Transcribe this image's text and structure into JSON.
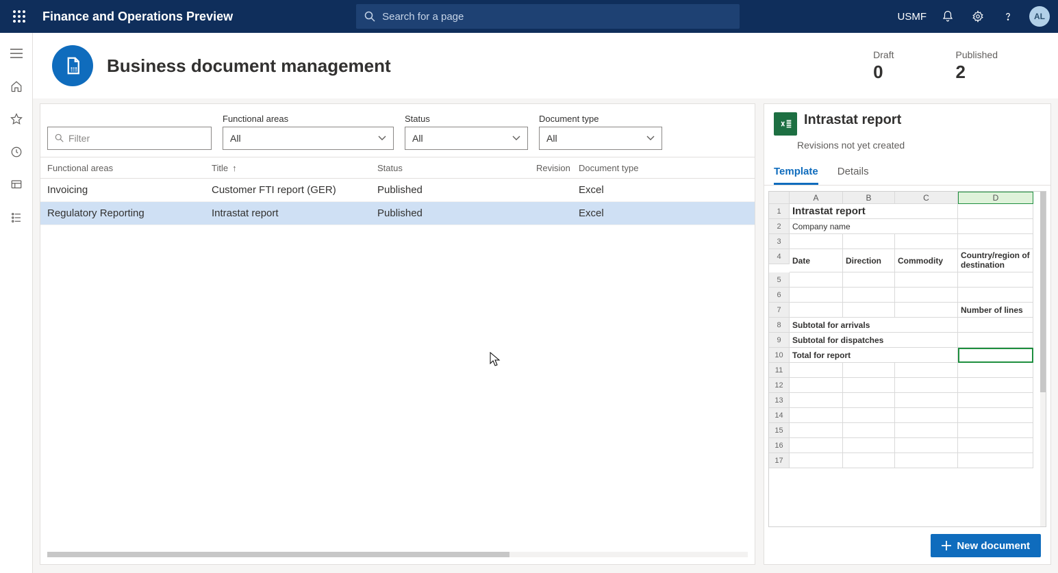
{
  "topbar": {
    "app_title": "Finance and Operations Preview",
    "search_placeholder": "Search for a page",
    "org": "USMF",
    "avatar_initials": "AL"
  },
  "page": {
    "title": "Business document management",
    "stats": {
      "draft_label": "Draft",
      "draft_value": "0",
      "published_label": "Published",
      "published_value": "2"
    }
  },
  "filters": {
    "filter_placeholder": "Filter",
    "fa_label": "Functional areas",
    "fa_value": "All",
    "status_label": "Status",
    "status_value": "All",
    "doctype_label": "Document type",
    "doctype_value": "All"
  },
  "table": {
    "headers": {
      "fa": "Functional areas",
      "title": "Title",
      "status": "Status",
      "revision": "Revision",
      "doctype": "Document type"
    },
    "rows": [
      {
        "fa": "Invoicing",
        "title": "Customer FTI report (GER)",
        "status": "Published",
        "revision": "",
        "doctype": "Excel",
        "selected": false
      },
      {
        "fa": "Regulatory Reporting",
        "title": "Intrastat report",
        "status": "Published",
        "revision": "",
        "doctype": "Excel",
        "selected": true
      }
    ],
    "sort_indicator": "↑"
  },
  "detail": {
    "title": "Intrastat report",
    "subtitle": "Revisions not yet created",
    "tabs": {
      "template": "Template",
      "details": "Details"
    },
    "sheet": {
      "cols": [
        "A",
        "B",
        "C",
        "D"
      ],
      "row1_a": "Intrastat report",
      "row2_a": "Company name",
      "row4": {
        "a": "Date",
        "b": "Direction",
        "c": "Commodity",
        "d": "Country/region of destination"
      },
      "row7_d": "Number of lines",
      "row8_a": "Subtotal for arrivals",
      "row9_a": "Subtotal for dispatches",
      "row10_a": "Total for report",
      "row_labels": [
        "1",
        "2",
        "3",
        "4",
        "5",
        "6",
        "7",
        "8",
        "9",
        "10",
        "11",
        "12",
        "13",
        "14",
        "15",
        "16",
        "17"
      ]
    },
    "newdoc_label": "New document"
  }
}
